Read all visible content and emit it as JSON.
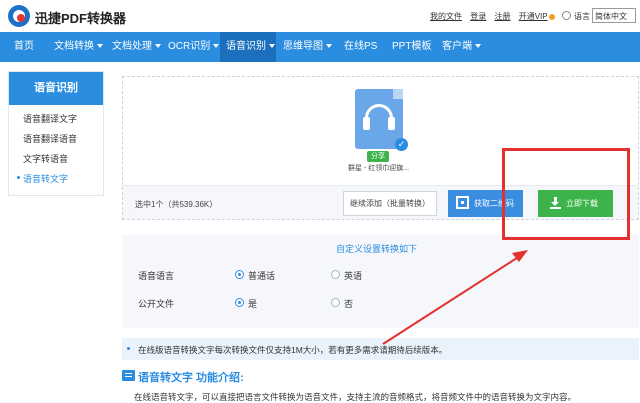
{
  "header": {
    "brand": "迅捷PDF转换器",
    "links": [
      "我的文件",
      "登录",
      "注册",
      "开通VIP"
    ],
    "language_label": "语言",
    "language_value": "简体中文"
  },
  "nav": {
    "items": [
      {
        "label": "首页",
        "has_caret": false
      },
      {
        "label": "文档转换",
        "has_caret": true
      },
      {
        "label": "文档处理",
        "has_caret": true
      },
      {
        "label": "OCR识别",
        "has_caret": true
      },
      {
        "label": "语音识别",
        "has_caret": true,
        "active": true
      },
      {
        "label": "思维导图",
        "has_caret": true
      },
      {
        "label": "在线PS",
        "has_caret": false
      },
      {
        "label": "PPT模板",
        "has_caret": false
      },
      {
        "label": "客户端",
        "has_caret": true
      }
    ]
  },
  "sidebar": {
    "title": "语音识别",
    "items": [
      {
        "label": "语音翻译文字"
      },
      {
        "label": "语音翻译语音"
      },
      {
        "label": "文字转语音"
      },
      {
        "label": "语音转文字",
        "active": true
      }
    ]
  },
  "upload": {
    "share_tag": "分享",
    "file_name": "群星 - 红领巾迎旗...",
    "selected_info": "选中1个（共539.36K）",
    "continue_button": "继续添加（批量转换）",
    "qr_button": "获取二维码",
    "download_button": "立即下载"
  },
  "settings": {
    "title": "自定义设置转换如下",
    "rows": [
      {
        "label": "语音语言",
        "options": [
          {
            "label": "普通话",
            "checked": true
          },
          {
            "label": "英语",
            "checked": false
          }
        ]
      },
      {
        "label": "公开文件",
        "options": [
          {
            "label": "是",
            "checked": true
          },
          {
            "label": "否",
            "checked": false
          }
        ]
      }
    ]
  },
  "notice": {
    "text": "在线版语音转换文字每次转换文件仅支持1M大小，若有更多需求请期待后续版本。"
  },
  "intro": {
    "title": "语音转文字 功能介绍:",
    "text": "在线语音转文字，可以直接把语言文件转换为语音文件，支持主流的音频格式，将音频文件中的语音转换为文字内容。"
  },
  "colors": {
    "primary": "#2b8de0",
    "nav_active": "#1c6fbd",
    "download_green": "#3db44b",
    "annotation_red": "#e2312e"
  }
}
